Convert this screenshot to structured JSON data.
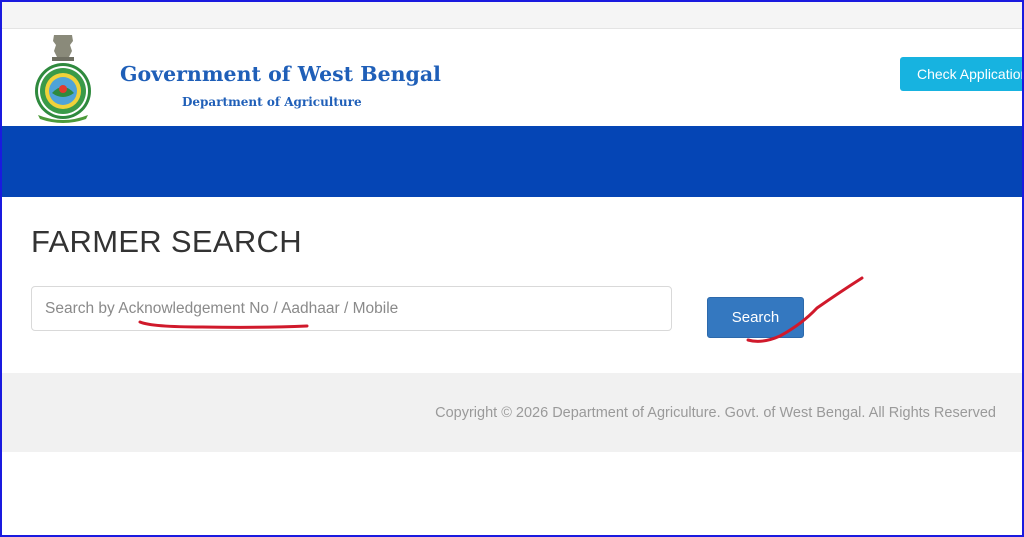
{
  "header": {
    "title": "Government of West Bengal",
    "subtitle": "Department of Agriculture",
    "check_button": "Check Application"
  },
  "main": {
    "page_title": "FARMER SEARCH",
    "search_placeholder": "Search by Acknowledgement No / Aadhaar / Mobile",
    "search_value": "",
    "search_button": "Search"
  },
  "footer": {
    "copyright": "Copyright © 2026 Department of Agriculture. Govt. of West Bengal. All Rights Reserved"
  },
  "icons": {
    "emblem": "west-bengal-emblem-icon"
  },
  "colors": {
    "brand_text": "#1f5fb8",
    "nav_bar": "#0545b5",
    "check_button": "#17b3e0",
    "search_button": "#3478c0",
    "annotation": "#d0192b",
    "frame_border": "#1a1adf"
  }
}
